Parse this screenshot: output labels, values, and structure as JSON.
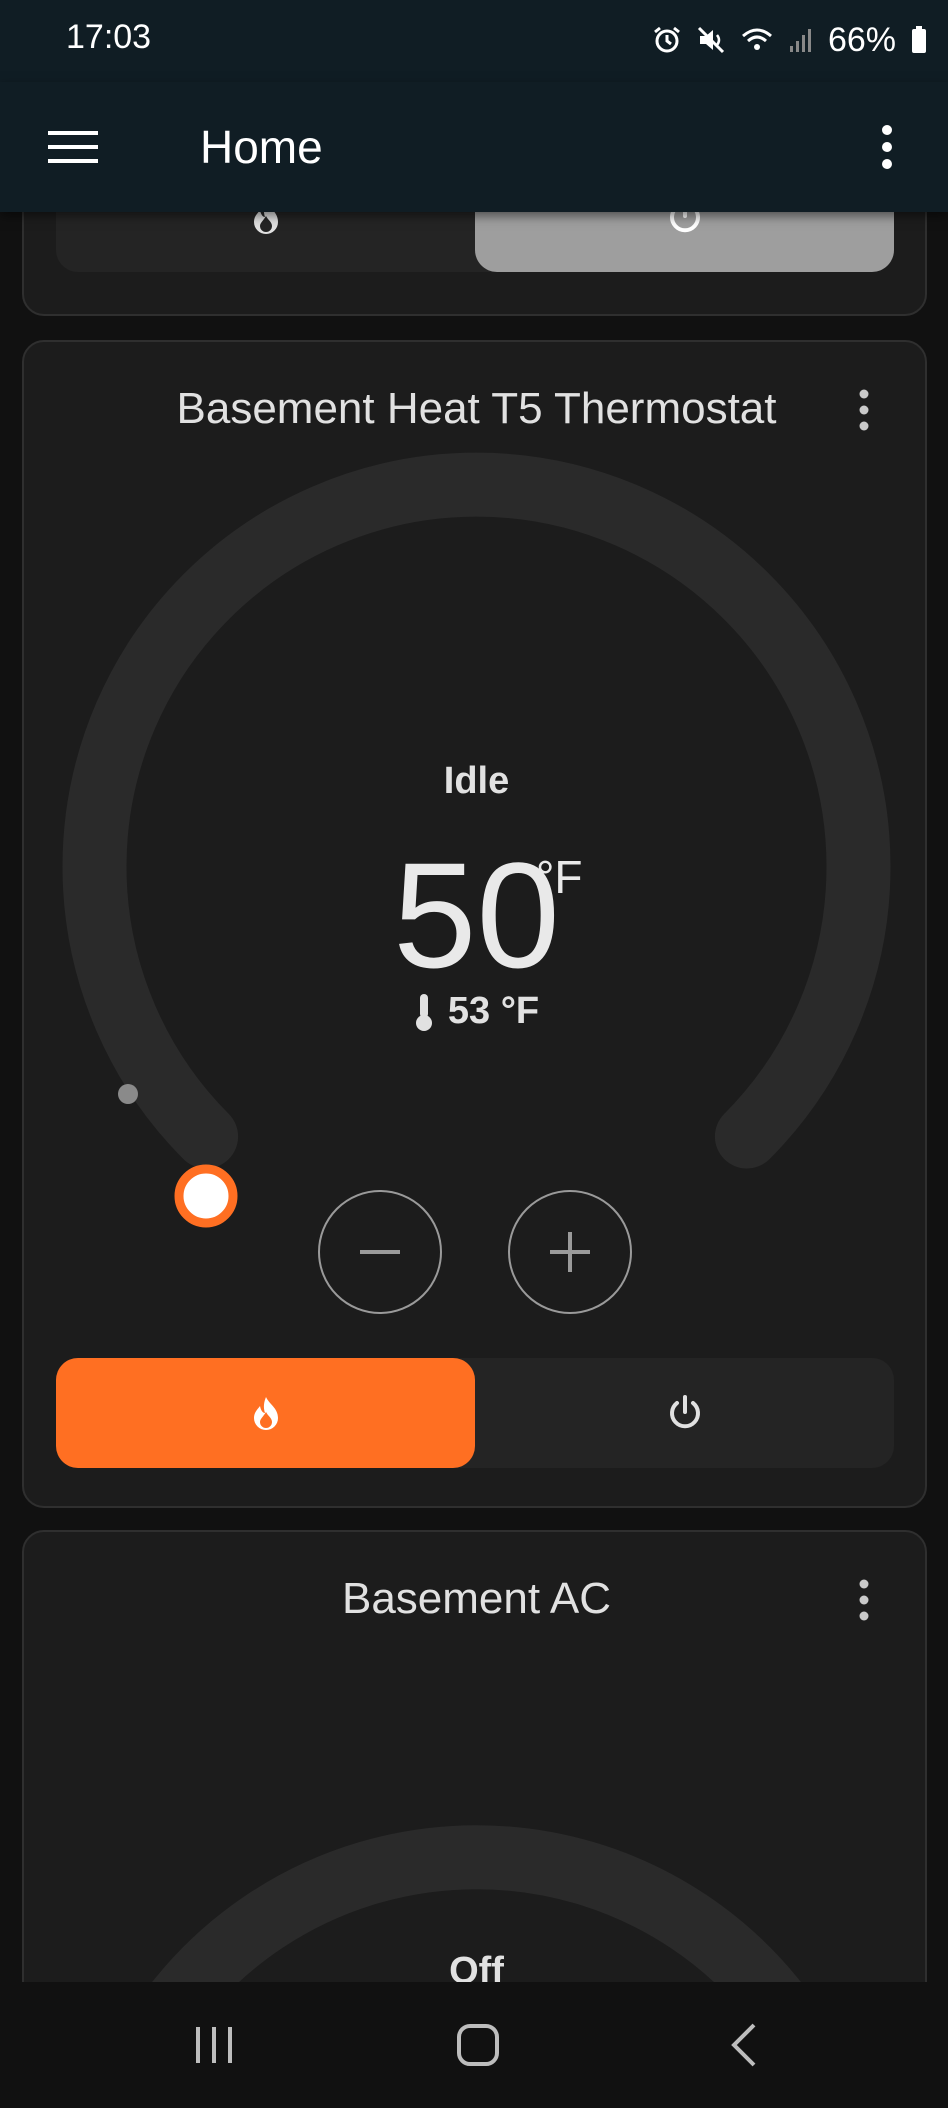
{
  "status_bar": {
    "time": "17:03",
    "battery": "66%",
    "icons": [
      "alarm-icon",
      "mute-icon",
      "wifi-icon",
      "signal-icon",
      "battery-icon"
    ]
  },
  "app_bar": {
    "title": "Home",
    "menu_icon": "hamburger-menu-icon",
    "overflow_icon": "more-vertical-icon"
  },
  "cards": {
    "previous": {
      "modes": [
        {
          "icon": "flame-icon",
          "active": false
        },
        {
          "icon": "power-icon",
          "active": true
        }
      ]
    },
    "basement_heat": {
      "title": "Basement Heat T5 Thermostat",
      "hvac_action": "Idle",
      "target_temperature": "50",
      "target_unit": "°F",
      "current_temperature": "53 °F",
      "modes": [
        {
          "icon": "flame-icon",
          "active": true
        },
        {
          "icon": "power-icon",
          "active": false
        }
      ]
    },
    "basement_ac": {
      "title": "Basement AC",
      "hvac_action": "Off"
    }
  },
  "colors": {
    "accent_heat": "#ff6f22",
    "card_bg": "#1c1c1c",
    "app_bar_bg": "#101d24",
    "active_off": "#9e9e9e"
  },
  "nav_bar": {
    "buttons": [
      "recents-icon",
      "home-icon",
      "back-icon"
    ]
  }
}
